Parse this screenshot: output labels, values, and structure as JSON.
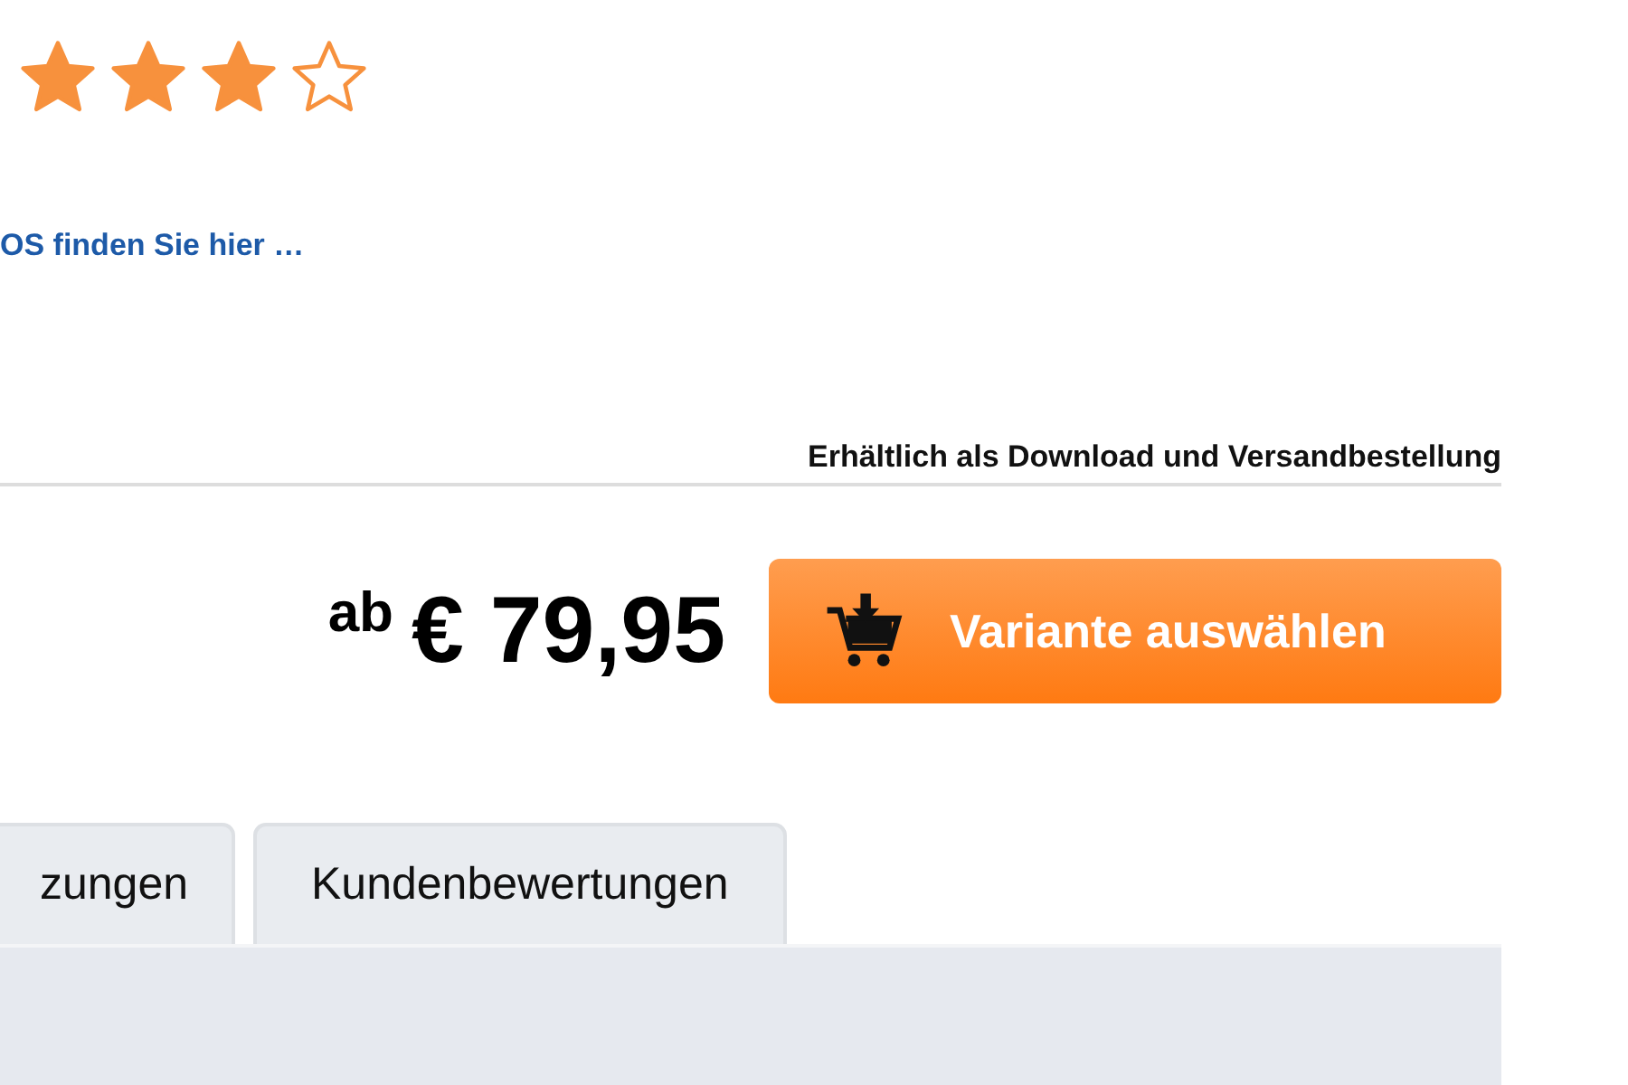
{
  "rating": {
    "stars": 3
  },
  "link": "OS finden Sie hier …",
  "availability": "Erhältlich als Download und Versandbestellung",
  "price": {
    "prefix": "ab",
    "amount": "€ 79,95"
  },
  "buy_button": "Variante auswählen",
  "tabs": [
    {
      "label": "zungen",
      "selected": false
    },
    {
      "label": "Kundenbewertungen",
      "selected": false
    }
  ]
}
